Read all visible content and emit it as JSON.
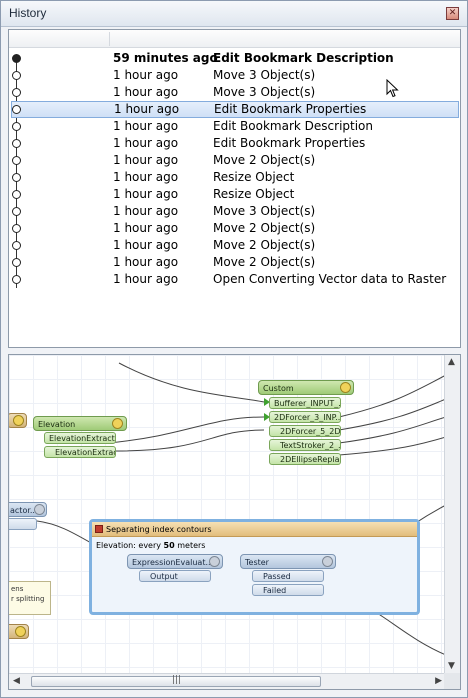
{
  "window": {
    "title": "History",
    "close_glyph": "✕"
  },
  "history": {
    "entries": [
      {
        "time": "59 minutes ago",
        "action": "Edit Bookmark Description",
        "bold": true,
        "node": "filled"
      },
      {
        "time": "1 hour ago",
        "action": "Move 3 Object(s)"
      },
      {
        "time": "1 hour ago",
        "action": "Move 3 Object(s)"
      },
      {
        "time": "1 hour ago",
        "action": "Edit Bookmark Properties",
        "selected": true
      },
      {
        "time": "1 hour ago",
        "action": "Edit Bookmark Description"
      },
      {
        "time": "1 hour ago",
        "action": "Edit Bookmark Properties"
      },
      {
        "time": "1 hour ago",
        "action": "Move 2 Object(s)"
      },
      {
        "time": "1 hour ago",
        "action": "Resize Object"
      },
      {
        "time": "1 hour ago",
        "action": "Resize Object"
      },
      {
        "time": "1 hour ago",
        "action": "Move 3 Object(s)"
      },
      {
        "time": "1 hour ago",
        "action": "Move 2 Object(s)"
      },
      {
        "time": "1 hour ago",
        "action": "Move 2 Object(s)"
      },
      {
        "time": "1 hour ago",
        "action": "Move 2 Object(s)"
      },
      {
        "time": "1 hour ago",
        "action": "Open Converting Vector data to Raster"
      }
    ]
  },
  "canvas": {
    "custom": {
      "title": "Custom",
      "ports": [
        "Bufferer_INPUT_...",
        "2DForcer_3_INP...",
        "2DForcer_5_2D...",
        "TextStroker_2_...",
        "2DEllipseReplac..."
      ]
    },
    "elevation": {
      "title": "Elevation",
      "ports": [
        "ElevationExtracto...",
        "ElevationExtrac..."
      ]
    },
    "left_node": {
      "title": "actor..."
    },
    "bookmark": {
      "title": "Separating index contours",
      "subtitle_prefix": "Elevation: every ",
      "subtitle_value": "50",
      "subtitle_suffix": " meters"
    },
    "expression": {
      "title": "ExpressionEvaluat...",
      "port": "Output"
    },
    "tester": {
      "title": "Tester",
      "ports": [
        "Passed",
        "Failed"
      ]
    },
    "note_text": [
      "ens",
      "r splitting"
    ],
    "scroll_grip": "|||"
  }
}
